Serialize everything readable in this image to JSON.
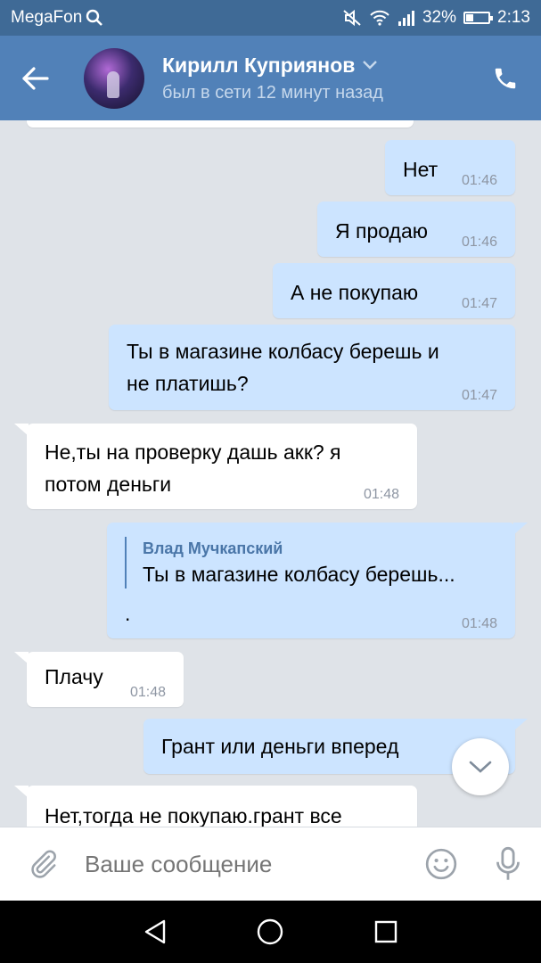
{
  "status_bar": {
    "carrier": "MegaFon",
    "battery": "32%",
    "battery_level": 0.32,
    "time": "2:13"
  },
  "header": {
    "name": "Кирилл Куприянов",
    "status": "был в сети 12 минут назад"
  },
  "messages": [
    {
      "dir": "out",
      "text": "Нет",
      "time": "01:46"
    },
    {
      "dir": "out",
      "text": "Я продаю",
      "time": "01:46"
    },
    {
      "dir": "out",
      "text": "А не покупаю",
      "time": "01:47"
    },
    {
      "dir": "out",
      "line1": "Ты в магазине колбасу берешь и",
      "line2": "не платишь?",
      "time": "01:47"
    },
    {
      "dir": "in",
      "line1": "Не,ты на проверку дашь акк? я",
      "line2": "потом деньги",
      "time": "01:48"
    },
    {
      "dir": "out",
      "reply_author": "Влад Мучкапский",
      "reply_text": "Ты в магазине колбасу берешь...",
      "text": ".",
      "time": "01:48"
    },
    {
      "dir": "in",
      "text": "Плачу",
      "time": "01:48"
    },
    {
      "dir": "out",
      "text": "Грант или деньги вперед"
    },
    {
      "dir": "in",
      "text": "Нет,тогда не покупаю.грант все"
    }
  ],
  "input": {
    "placeholder": "Ваше сообщение"
  },
  "colors": {
    "header": "#5181b8",
    "status_bar": "#3f6a96",
    "outgoing": "#cce4ff",
    "incoming": "#ffffff",
    "background": "#dfe3e8"
  },
  "icons": [
    "search-icon",
    "mute-icon",
    "wifi-icon",
    "signal-icon",
    "battery-icon",
    "back-arrow-icon",
    "chevron-down-icon",
    "phone-icon",
    "attach-icon",
    "emoji-icon",
    "microphone-icon",
    "nav-back-icon",
    "nav-home-icon",
    "nav-recents-icon"
  ]
}
